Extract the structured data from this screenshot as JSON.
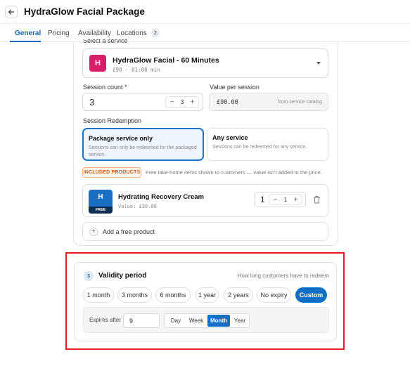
{
  "header": {
    "title": "HydraGlow Facial Package"
  },
  "tabs": [
    {
      "label": "General",
      "active": true
    },
    {
      "label": "Pricing"
    },
    {
      "label": "Availability"
    },
    {
      "label": "Locations",
      "count": "2"
    }
  ],
  "service": {
    "section_label": "Select a service",
    "icon_letter": "H",
    "name": "HydraGlow Facial - 60 Minutes",
    "sub": "£90 · 01:00 min"
  },
  "session_count": {
    "label": "Session count *",
    "value": "3",
    "stepper_value": "3",
    "minus": "−",
    "plus": "+"
  },
  "value_per_session": {
    "label": "Value per session",
    "value": "£90.00",
    "hint": "from service catalog"
  },
  "redemption": {
    "label": "Session Redemption",
    "options": [
      {
        "title": "Package service only",
        "desc": "Sessions can only be redeemed for the packaged service.",
        "selected": true
      },
      {
        "title": "Any service",
        "desc": "Sessions can be redeemed for any service.",
        "selected": false
      }
    ]
  },
  "included": {
    "badge": "INCLUDED PRODUCTS",
    "note": "Free take-home items shown to customers — value isn't added to the price.",
    "product": {
      "icon_letter": "H",
      "icon_badge": "FREE",
      "name": "Hydrating Recovery Cream",
      "value": "Value: £30.00",
      "qty": "1",
      "stepper_value": "1",
      "minus": "−",
      "plus": "+"
    },
    "add_label": "Add a free product",
    "add_symbol": "+"
  },
  "validity": {
    "step": "3",
    "title": "Validity period",
    "hint": "How long customers have to redeem",
    "chips": [
      "1 month",
      "3 months",
      "6 months",
      "1 year",
      "2 years",
      "No expiry",
      "Custom"
    ],
    "active_chip": "Custom",
    "expires_label": "Expires after",
    "expires_value": "9",
    "units": [
      "Day",
      "Week",
      "Month",
      "Year"
    ],
    "active_unit": "Month"
  },
  "colors": {
    "accent": "#0e6fc6",
    "service_icon": "#d61f69",
    "highlight_box": "#e21e1e"
  }
}
